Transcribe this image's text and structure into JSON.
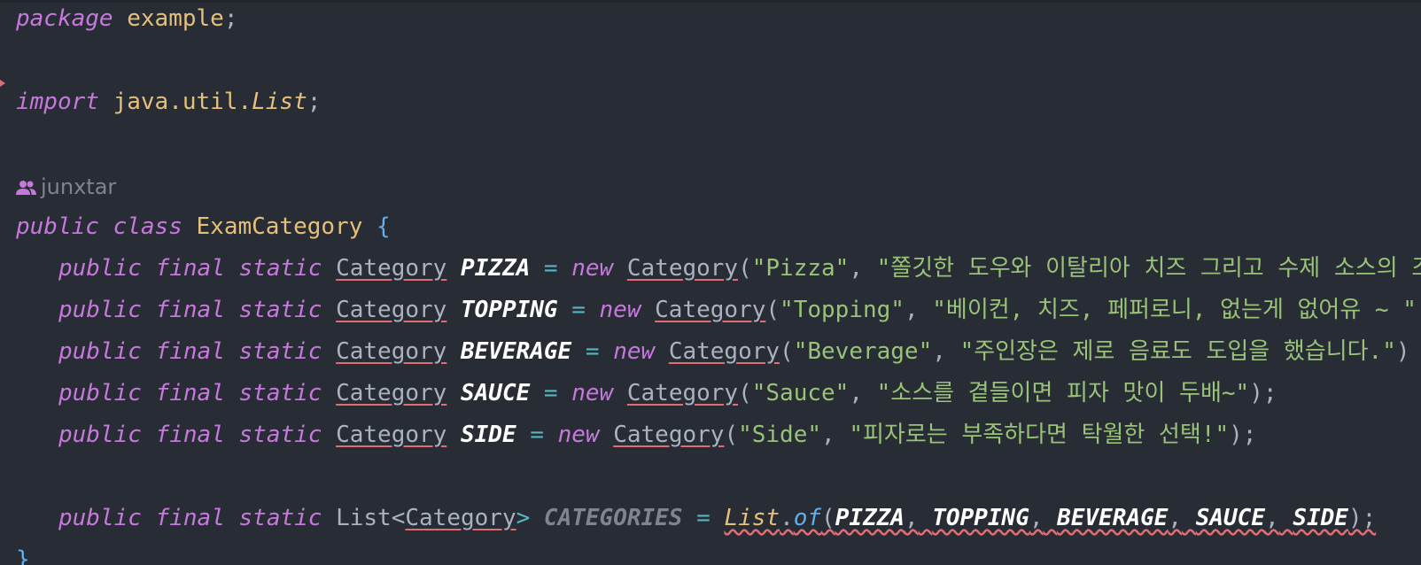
{
  "code": {
    "line1": {
      "kw": "package",
      "pkg": "example",
      "semi": ";"
    },
    "line2": {
      "kw": "import",
      "pkg": "java.util.",
      "cls": "List",
      "semi": ";"
    },
    "author": "junxtar",
    "line3": {
      "kw1": "public",
      "kw2": "class",
      "name": "ExamCategory",
      "brace": "{"
    },
    "decls": [
      {
        "k1": "public",
        "k2": "final",
        "k3": "static",
        "type": "Category",
        "name": "PIZZA",
        "eq": "=",
        "newkw": "new",
        "ctor": "Category",
        "open": "(",
        "a1": "\"Pizza\"",
        "comma": ",",
        "a2": "\"쫄깃한 도우와 이탈리아 치즈 그리고 수제 소스의 조",
        "close": ""
      },
      {
        "k1": "public",
        "k2": "final",
        "k3": "static",
        "type": "Category",
        "name": "TOPPING",
        "eq": "=",
        "newkw": "new",
        "ctor": "Category",
        "open": "(",
        "a1": "\"Topping\"",
        "comma": ",",
        "a2": "\"베이컨, 치즈, 페퍼로니, 없는게 없어유 ~ \"",
        "close": ""
      },
      {
        "k1": "public",
        "k2": "final",
        "k3": "static",
        "type": "Category",
        "name": "BEVERAGE",
        "eq": "=",
        "newkw": "new",
        "ctor": "Category",
        "open": "(",
        "a1": "\"Beverage\"",
        "comma": ",",
        "a2": "\"주인장은 제로 음료도 도입을 했습니다.\"",
        "close": ")"
      },
      {
        "k1": "public",
        "k2": "final",
        "k3": "static",
        "type": "Category",
        "name": "SAUCE",
        "eq": "=",
        "newkw": "new",
        "ctor": "Category",
        "open": "(",
        "a1": "\"Sauce\"",
        "comma": ",",
        "a2": "\"소스를 곁들이면 피자 맛이 두배~\"",
        "close": ");"
      },
      {
        "k1": "public",
        "k2": "final",
        "k3": "static",
        "type": "Category",
        "name": "SIDE",
        "eq": "=",
        "newkw": "new",
        "ctor": "Category",
        "open": "(",
        "a1": "\"Side\"",
        "comma": ",",
        "a2": "\"피자로는 부족하다면 탁월한 선택!\"",
        "close": ");"
      }
    ],
    "list_line": {
      "k1": "public",
      "k2": "final",
      "k3": "static",
      "t1": "List<",
      "t2": "Category",
      "t3": ">",
      "name": "CATEGORIES",
      "eq": "=",
      "cls": "List",
      "dot": ".",
      "method": "of",
      "open": "(",
      "args": [
        "PIZZA",
        "TOPPING",
        "BEVERAGE",
        "SAUCE",
        "SIDE"
      ],
      "sep": ",",
      "close": ");"
    },
    "last_brace": "}"
  }
}
